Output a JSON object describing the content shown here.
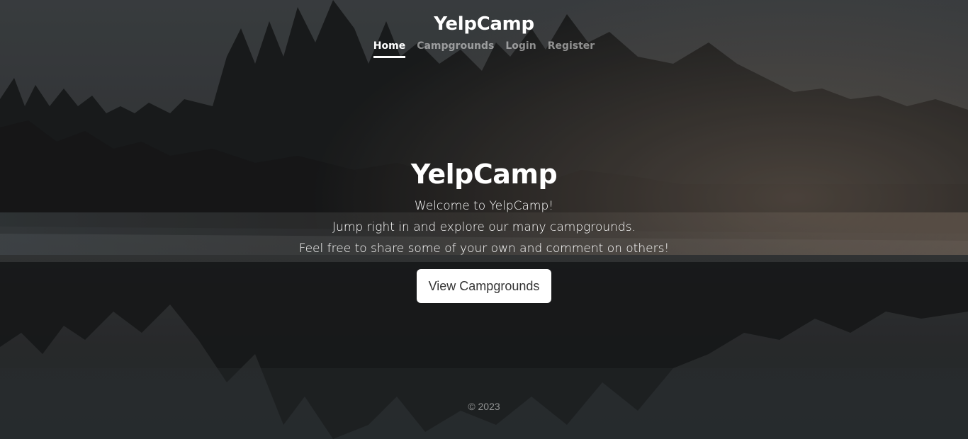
{
  "brand": "YelpCamp",
  "nav": {
    "items": [
      {
        "label": "Home",
        "active": true
      },
      {
        "label": "Campgrounds",
        "active": false
      },
      {
        "label": "Login",
        "active": false
      },
      {
        "label": "Register",
        "active": false
      }
    ]
  },
  "hero": {
    "title": "YelpCamp",
    "lines": [
      "Welcome to YelpCamp!",
      "Jump right in and explore our many campgrounds.",
      "Feel free to share some of your own and comment on others!"
    ],
    "button_label": "View Campgrounds"
  },
  "footer": {
    "text": "© 2023"
  },
  "colors": {
    "text": "#ffffff",
    "muted_nav": "rgba(255,255,255,0.5)",
    "button_bg": "#ffffff",
    "button_text": "#333333"
  }
}
